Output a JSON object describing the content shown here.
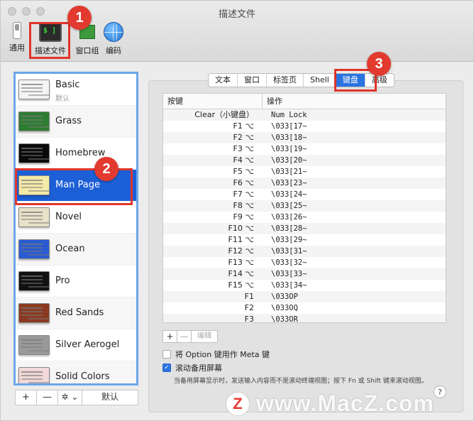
{
  "window": {
    "title": "描述文件"
  },
  "toolbar": {
    "items": [
      {
        "label": "通用"
      },
      {
        "label": "描述文件"
      },
      {
        "label": "窗口组"
      },
      {
        "label": "编码"
      }
    ]
  },
  "profiles": {
    "default_label": "默认",
    "items": [
      {
        "name": "Basic",
        "thumb_color": "#f4f4f4",
        "is_default": true
      },
      {
        "name": "Grass",
        "thumb_color": "#2e7d32"
      },
      {
        "name": "Homebrew",
        "thumb_color": "#0a0a0a"
      },
      {
        "name": "Man Page",
        "thumb_color": "#f3e9a8",
        "selected": true
      },
      {
        "name": "Novel",
        "thumb_color": "#e9e1c8"
      },
      {
        "name": "Ocean",
        "thumb_color": "#2a5bd1"
      },
      {
        "name": "Pro",
        "thumb_color": "#111111"
      },
      {
        "name": "Red Sands",
        "thumb_color": "#8a3a22"
      },
      {
        "name": "Silver Aerogel",
        "thumb_color": "#9a9a9a"
      },
      {
        "name": "Solid Colors",
        "thumb_color": "#f2d8d8"
      }
    ],
    "bottom": {
      "add": "+",
      "remove": "—",
      "gear": "✲ ⌄",
      "default": "默认"
    }
  },
  "tabs": {
    "items": [
      "文本",
      "窗口",
      "标签页",
      "Shell",
      "键盘",
      "高级"
    ],
    "active_index": 4
  },
  "keyboard": {
    "col_key": "按键",
    "col_action": "操作",
    "rows": [
      {
        "key": "Clear（小键盘）",
        "action": "Num Lock"
      },
      {
        "key": "F1 ⌥",
        "action": "\\033[17~"
      },
      {
        "key": "F2 ⌥",
        "action": "\\033[18~"
      },
      {
        "key": "F3 ⌥",
        "action": "\\033[19~"
      },
      {
        "key": "F4 ⌥",
        "action": "\\033[20~"
      },
      {
        "key": "F5 ⌥",
        "action": "\\033[21~"
      },
      {
        "key": "F6 ⌥",
        "action": "\\033[23~"
      },
      {
        "key": "F7 ⌥",
        "action": "\\033[24~"
      },
      {
        "key": "F8 ⌥",
        "action": "\\033[25~"
      },
      {
        "key": "F9 ⌥",
        "action": "\\033[26~"
      },
      {
        "key": "F10 ⌥",
        "action": "\\033[28~"
      },
      {
        "key": "F11 ⌥",
        "action": "\\033[29~"
      },
      {
        "key": "F12 ⌥",
        "action": "\\033[31~"
      },
      {
        "key": "F13 ⌥",
        "action": "\\033[32~"
      },
      {
        "key": "F14 ⌥",
        "action": "\\033[33~"
      },
      {
        "key": "F15 ⌥",
        "action": "\\033[34~"
      },
      {
        "key": "F1",
        "action": "\\033OP"
      },
      {
        "key": "F2",
        "action": "\\033OQ"
      },
      {
        "key": "F3",
        "action": "\\033OR"
      }
    ],
    "edit_bar": {
      "add": "+",
      "remove": "—",
      "edit": "编辑"
    },
    "option_meta": {
      "label": "将 Option 键用作 Meta 键",
      "checked": false
    },
    "scroll_alt": {
      "label": "滚动备用屏幕",
      "checked": true
    },
    "note": "当备用屏幕显示时，发送输入内容而不是滚动终端视图；按下 Fn 或 Shift 键来滚动视图。",
    "help": "?"
  },
  "annotations": {
    "badge1": "1",
    "badge2": "2",
    "badge3": "3"
  },
  "watermark": {
    "logo": "Z",
    "text": "www.MacZ.com"
  },
  "colors": {
    "accent": "#2b73e0",
    "selection": "#1c5fd6",
    "annotation": "#e0352b",
    "list_border": "#6aa6e8"
  }
}
